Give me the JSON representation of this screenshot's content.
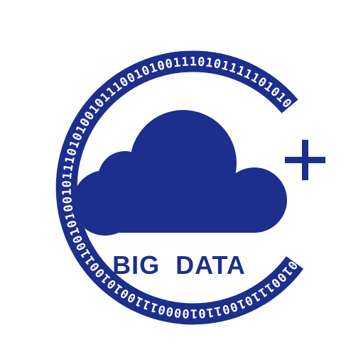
{
  "logo": {
    "wordmark": "BIG  DATA",
    "binary_ring_text": "01001110100110100001110010100110010100101110101001011100101001110101111101010001101010100111111",
    "plus_symbol": "+"
  },
  "colors": {
    "primary": "#1c2f8c",
    "background": "#ffffff",
    "ring_text": "#ffffff"
  },
  "icons": [
    "cloud-icon",
    "binary-ring-icon",
    "plus-icon"
  ]
}
